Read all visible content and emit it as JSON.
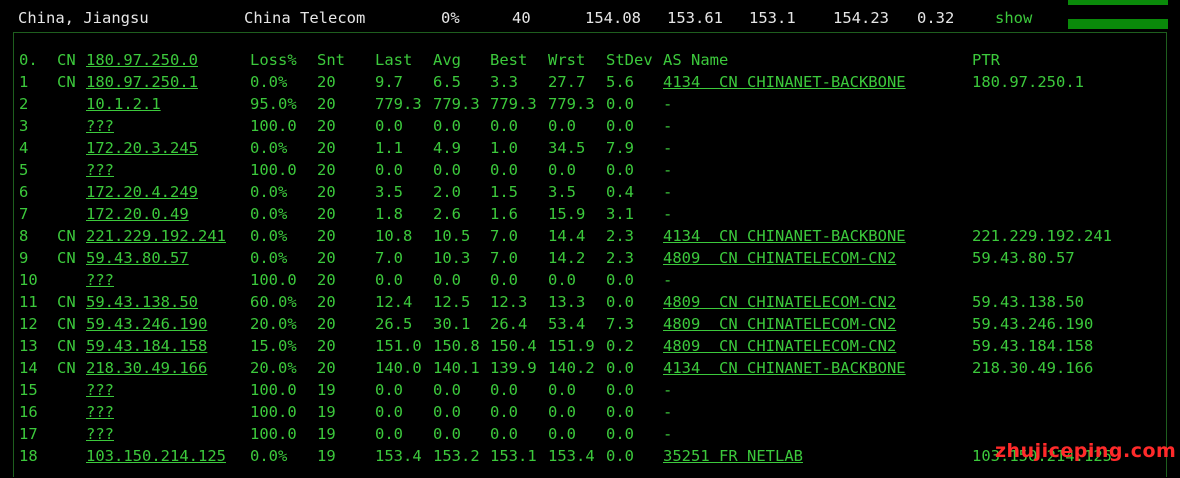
{
  "summary": {
    "location": "China, Jiangsu",
    "isp": "China Telecom",
    "loss": "0%",
    "sent": "40",
    "last": "154.08",
    "avg": "153.61",
    "best": "153.1",
    "worst": "154.23",
    "stdev": "0.32",
    "action": "show"
  },
  "headers": {
    "hop": "0.",
    "cc": "CN",
    "host": "180.97.250.0",
    "loss": "Loss%",
    "snt": "Snt",
    "last": "Last",
    "avg": "Avg",
    "best": "Best",
    "wrst": "Wrst",
    "stdev": "StDev",
    "as": "AS Name",
    "ptr": "PTR"
  },
  "rows": [
    {
      "hop": "1",
      "cc": "CN",
      "host": "180.97.250.1",
      "loss": "0.0%",
      "snt": "20",
      "last": "9.7",
      "avg": "6.5",
      "best": "3.3",
      "wrst": "27.7",
      "stdev": "5.6",
      "as": "4134  CN CHINANET-BACKBONE",
      "ptr": "180.97.250.1"
    },
    {
      "hop": "2",
      "cc": "",
      "host": "10.1.2.1",
      "loss": "95.0%",
      "snt": "20",
      "last": "779.3",
      "avg": "779.3",
      "best": "779.3",
      "wrst": "779.3",
      "stdev": "0.0",
      "as": "-",
      "ptr": ""
    },
    {
      "hop": "3",
      "cc": "",
      "host": "???",
      "loss": "100.0",
      "snt": "20",
      "last": "0.0",
      "avg": "0.0",
      "best": "0.0",
      "wrst": "0.0",
      "stdev": "0.0",
      "as": "-",
      "ptr": ""
    },
    {
      "hop": "4",
      "cc": "",
      "host": "172.20.3.245",
      "loss": "0.0%",
      "snt": "20",
      "last": "1.1",
      "avg": "4.9",
      "best": "1.0",
      "wrst": "34.5",
      "stdev": "7.9",
      "as": "-",
      "ptr": ""
    },
    {
      "hop": "5",
      "cc": "",
      "host": "???",
      "loss": "100.0",
      "snt": "20",
      "last": "0.0",
      "avg": "0.0",
      "best": "0.0",
      "wrst": "0.0",
      "stdev": "0.0",
      "as": "-",
      "ptr": ""
    },
    {
      "hop": "6",
      "cc": "",
      "host": "172.20.4.249",
      "loss": "0.0%",
      "snt": "20",
      "last": "3.5",
      "avg": "2.0",
      "best": "1.5",
      "wrst": "3.5",
      "stdev": "0.4",
      "as": "-",
      "ptr": ""
    },
    {
      "hop": "7",
      "cc": "",
      "host": "172.20.0.49",
      "loss": "0.0%",
      "snt": "20",
      "last": "1.8",
      "avg": "2.6",
      "best": "1.6",
      "wrst": "15.9",
      "stdev": "3.1",
      "as": "-",
      "ptr": ""
    },
    {
      "hop": "8",
      "cc": "CN",
      "host": "221.229.192.241",
      "loss": "0.0%",
      "snt": "20",
      "last": "10.8",
      "avg": "10.5",
      "best": "7.0",
      "wrst": "14.4",
      "stdev": "2.3",
      "as": "4134  CN CHINANET-BACKBONE",
      "ptr": "221.229.192.241"
    },
    {
      "hop": "9",
      "cc": "CN",
      "host": "59.43.80.57",
      "loss": "0.0%",
      "snt": "20",
      "last": "7.0",
      "avg": "10.3",
      "best": "7.0",
      "wrst": "14.2",
      "stdev": "2.3",
      "as": "4809  CN CHINATELECOM-CN2",
      "ptr": "59.43.80.57"
    },
    {
      "hop": "10",
      "cc": "",
      "host": "???",
      "loss": "100.0",
      "snt": "20",
      "last": "0.0",
      "avg": "0.0",
      "best": "0.0",
      "wrst": "0.0",
      "stdev": "0.0",
      "as": "-",
      "ptr": ""
    },
    {
      "hop": "11",
      "cc": "CN",
      "host": "59.43.138.50",
      "loss": "60.0%",
      "snt": "20",
      "last": "12.4",
      "avg": "12.5",
      "best": "12.3",
      "wrst": "13.3",
      "stdev": "0.0",
      "as": "4809  CN CHINATELECOM-CN2",
      "ptr": "59.43.138.50"
    },
    {
      "hop": "12",
      "cc": "CN",
      "host": "59.43.246.190",
      "loss": "20.0%",
      "snt": "20",
      "last": "26.5",
      "avg": "30.1",
      "best": "26.4",
      "wrst": "53.4",
      "stdev": "7.3",
      "as": "4809  CN CHINATELECOM-CN2",
      "ptr": "59.43.246.190"
    },
    {
      "hop": "13",
      "cc": "CN",
      "host": "59.43.184.158",
      "loss": "15.0%",
      "snt": "20",
      "last": "151.0",
      "avg": "150.8",
      "best": "150.4",
      "wrst": "151.9",
      "stdev": "0.2",
      "as": "4809  CN CHINATELECOM-CN2",
      "ptr": "59.43.184.158"
    },
    {
      "hop": "14",
      "cc": "CN",
      "host": "218.30.49.166",
      "loss": "20.0%",
      "snt": "20",
      "last": "140.0",
      "avg": "140.1",
      "best": "139.9",
      "wrst": "140.2",
      "stdev": "0.0",
      "as": "4134  CN CHINANET-BACKBONE",
      "ptr": "218.30.49.166"
    },
    {
      "hop": "15",
      "cc": "",
      "host": "???",
      "loss": "100.0",
      "snt": "19",
      "last": "0.0",
      "avg": "0.0",
      "best": "0.0",
      "wrst": "0.0",
      "stdev": "0.0",
      "as": "-",
      "ptr": ""
    },
    {
      "hop": "16",
      "cc": "",
      "host": "???",
      "loss": "100.0",
      "snt": "19",
      "last": "0.0",
      "avg": "0.0",
      "best": "0.0",
      "wrst": "0.0",
      "stdev": "0.0",
      "as": "-",
      "ptr": ""
    },
    {
      "hop": "17",
      "cc": "",
      "host": "???",
      "loss": "100.0",
      "snt": "19",
      "last": "0.0",
      "avg": "0.0",
      "best": "0.0",
      "wrst": "0.0",
      "stdev": "0.0",
      "as": "-",
      "ptr": ""
    },
    {
      "hop": "18",
      "cc": "",
      "host": "103.150.214.125",
      "loss": "0.0%",
      "snt": "19",
      "last": "153.4",
      "avg": "153.2",
      "best": "153.1",
      "wrst": "153.4",
      "stdev": "0.0",
      "as": "35251 FR NETLAB",
      "ptr": "103.150.214.125"
    }
  ],
  "watermark": "zhujiceping.com",
  "colors": {
    "text": "#3cc93c",
    "summary_text": "#e6e6e6",
    "bar": "#0a8a0a",
    "watermark": "#ff2a2a",
    "background": "#000000"
  }
}
